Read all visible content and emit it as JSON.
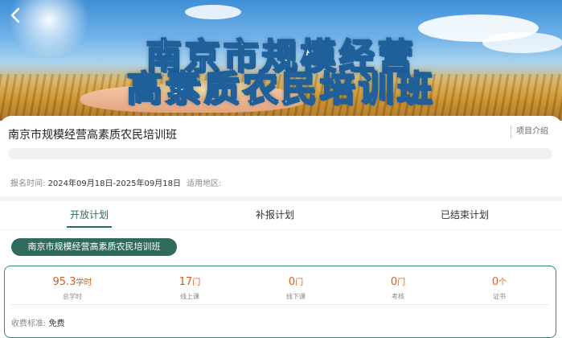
{
  "banner": {
    "line1": "南京市规模经营",
    "line2": "高素质农民培训班"
  },
  "course": {
    "title": "南京市规模经营高素质农民培训班",
    "intro_link": "项目介绍",
    "signup_label": "报名时间:",
    "signup_dates": "2024年09月18日-2025年09月18日",
    "region_label": "适用地区:"
  },
  "tabs": [
    {
      "label": "开放计划",
      "active": true
    },
    {
      "label": "补报计划",
      "active": false
    },
    {
      "label": "已结束计划",
      "active": false
    }
  ],
  "plan": {
    "name": "南京市规模经营高素质农民培训班",
    "stats": [
      {
        "value": "95.3",
        "unit": "学时",
        "label": "总学时"
      },
      {
        "value": "17",
        "unit": "门",
        "label": "线上课"
      },
      {
        "value": "0",
        "unit": "门",
        "label": "线下课"
      },
      {
        "value": "0",
        "unit": "门",
        "label": "考核"
      },
      {
        "value": "0",
        "unit": "个",
        "label": "证书"
      }
    ],
    "fee_label": "收费标准:",
    "fee_value": "免费"
  },
  "colors": {
    "accent": "#2e6b5c",
    "number": "#e05a1a"
  },
  "icons": {
    "back": "chevron-left-icon"
  }
}
